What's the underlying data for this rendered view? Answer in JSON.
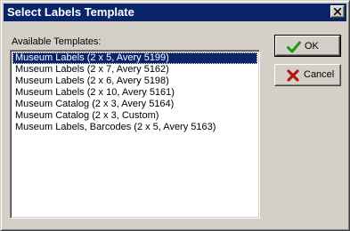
{
  "window": {
    "title": "Select Labels Template",
    "close_icon": "close-x-icon"
  },
  "templates": {
    "label": "Available Templates:",
    "selected_index": 0,
    "items": [
      "Museum Labels (2 x 5, Avery 5199)",
      "Museum Labels (2 x 7, Avery 5162)",
      "Museum Labels (2 x 6, Avery 5198)",
      "Museum Labels (2 x 10, Avery 5161)",
      "Museum Catalog (2 x 3, Avery 5164)",
      "Museum Catalog (2 x 3, Custom)",
      "Museum Labels, Barcodes (2 x 5, Avery 5163)"
    ]
  },
  "buttons": {
    "ok_label": "OK",
    "ok_icon": "green-checkmark-icon",
    "cancel_label": "Cancel",
    "cancel_icon": "red-x-icon"
  },
  "colors": {
    "titlebar": "#0a246a",
    "selection": "#0a246a",
    "ok_check": "#1a9a1a",
    "cancel_x": "#b01818",
    "face": "#d4d0c8"
  }
}
